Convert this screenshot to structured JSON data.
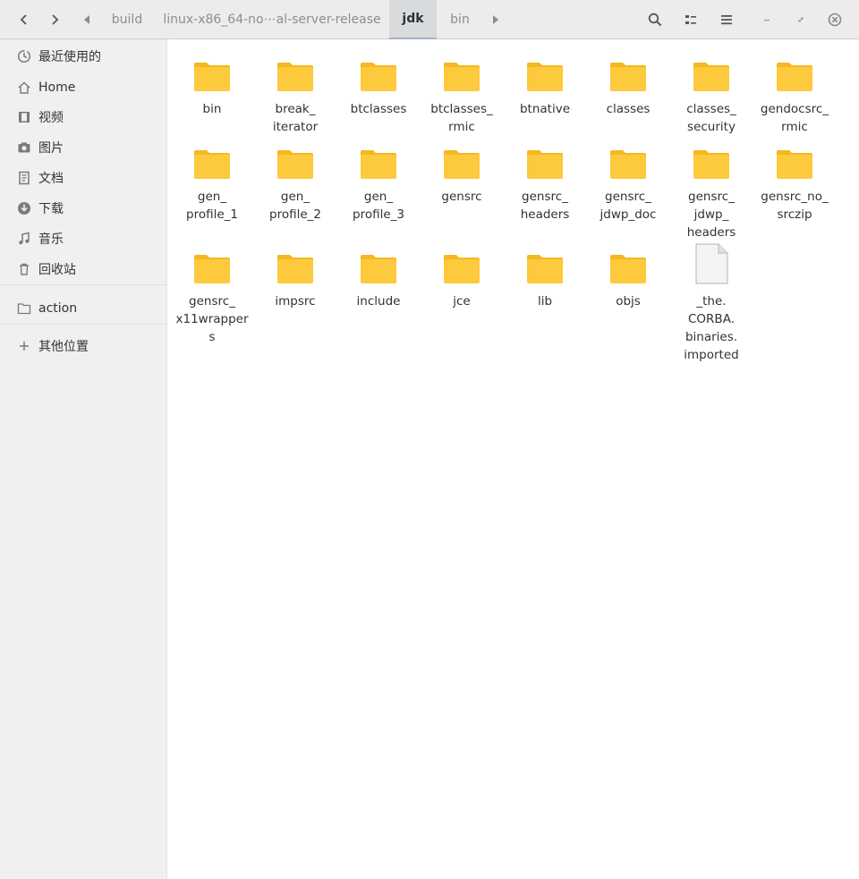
{
  "header": {
    "breadcrumbs": [
      "build",
      "linux-x86_64-no⋯al-server-release",
      "jdk",
      "bin"
    ],
    "active_crumb": "jdk"
  },
  "sidebar": {
    "items": [
      {
        "label": "最近使用的",
        "icon": "clock-icon"
      },
      {
        "label": "Home",
        "icon": "home-icon"
      },
      {
        "label": "视频",
        "icon": "film-icon"
      },
      {
        "label": "图片",
        "icon": "camera-icon"
      },
      {
        "label": "文档",
        "icon": "document-icon"
      },
      {
        "label": "下载",
        "icon": "download-icon"
      },
      {
        "label": "音乐",
        "icon": "music-icon"
      },
      {
        "label": "回收站",
        "icon": "trash-icon"
      }
    ],
    "bookmarks": [
      {
        "label": "action",
        "icon": "folder-icon"
      }
    ],
    "other_locations": {
      "label": "其他位置",
      "icon": "plus-icon"
    }
  },
  "files": [
    {
      "name": "bin",
      "type": "folder"
    },
    {
      "name": "break_\niterator",
      "type": "folder"
    },
    {
      "name": "btclasses",
      "type": "folder"
    },
    {
      "name": "btclasses_\nrmic",
      "type": "folder"
    },
    {
      "name": "btnative",
      "type": "folder"
    },
    {
      "name": "classes",
      "type": "folder"
    },
    {
      "name": "classes_\nsecurity",
      "type": "folder"
    },
    {
      "name": "gendocsrc_\nrmic",
      "type": "folder"
    },
    {
      "name": "gen_\nprofile_1",
      "type": "folder"
    },
    {
      "name": "gen_\nprofile_2",
      "type": "folder"
    },
    {
      "name": "gen_\nprofile_3",
      "type": "folder"
    },
    {
      "name": "gensrc",
      "type": "folder"
    },
    {
      "name": "gensrc_\nheaders",
      "type": "folder"
    },
    {
      "name": "gensrc_\njdwp_doc",
      "type": "folder"
    },
    {
      "name": "gensrc_\njdwp_\nheaders",
      "type": "folder"
    },
    {
      "name": "gensrc_no_\nsrczip",
      "type": "folder"
    },
    {
      "name": "gensrc_\nx11wrapper\ns",
      "type": "folder"
    },
    {
      "name": "impsrc",
      "type": "folder"
    },
    {
      "name": "include",
      "type": "folder"
    },
    {
      "name": "jce",
      "type": "folder"
    },
    {
      "name": "lib",
      "type": "folder"
    },
    {
      "name": "objs",
      "type": "folder"
    },
    {
      "name": "_the.\nCORBA.\nbinaries.\nimported",
      "type": "file"
    }
  ],
  "colors": {
    "folder": "#fdc93d",
    "folder_tab": "#f5b820",
    "headerbar": "#ececec",
    "sidebar": "#f0f0f0",
    "active_crumb": "#d9dadc"
  }
}
